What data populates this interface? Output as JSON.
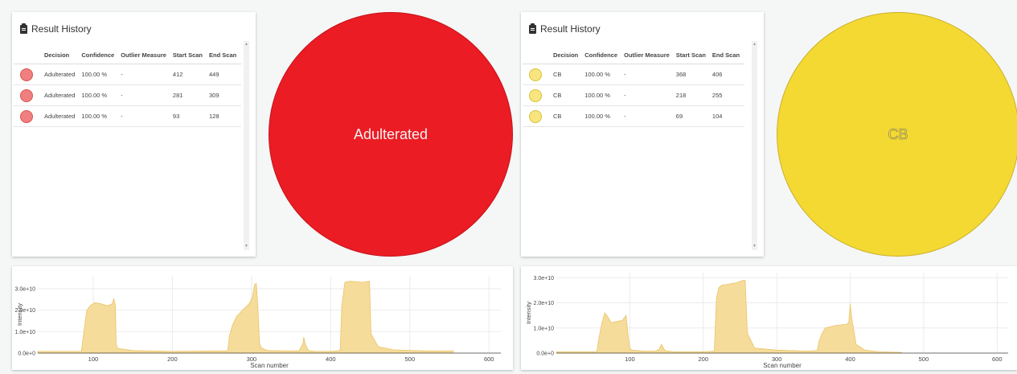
{
  "left_panel": {
    "title": "Result History",
    "columns": [
      "",
      "Decision",
      "Confidence",
      "Outlier Measure",
      "Start Scan",
      "End Scan"
    ],
    "rows": [
      {
        "decision": "Adulterated",
        "confidence": "100.00 %",
        "outlier": "-",
        "start": "412",
        "end": "449"
      },
      {
        "decision": "Adulterated",
        "confidence": "100.00 %",
        "outlier": "-",
        "start": "281",
        "end": "309"
      },
      {
        "decision": "Adulterated",
        "confidence": "100.00 %",
        "outlier": "-",
        "start": "93",
        "end": "128"
      }
    ],
    "status_label": "Adulterated",
    "status_color": "#ec1c24"
  },
  "right_panel": {
    "title": "Result History",
    "columns": [
      "",
      "Decision",
      "Confidence",
      "Outlier Measure",
      "Start Scan",
      "End Scan"
    ],
    "rows": [
      {
        "decision": "CB",
        "confidence": "100.00 %",
        "outlier": "-",
        "start": "368",
        "end": "406"
      },
      {
        "decision": "CB",
        "confidence": "100.00 %",
        "outlier": "-",
        "start": "218",
        "end": "255"
      },
      {
        "decision": "CB",
        "confidence": "100.00 %",
        "outlier": "-",
        "start": "69",
        "end": "104"
      }
    ],
    "status_label": "CB",
    "status_color": "#f5d933"
  },
  "icons": {
    "title_icon": "clipboard-icon",
    "row_icon": "decision-dot-icon"
  },
  "chart_data": [
    {
      "type": "area",
      "title": "",
      "xlabel": "Scan number",
      "ylabel": "Intensity",
      "xlim": [
        30,
        615
      ],
      "ylim": [
        0,
        36000000000.0
      ],
      "xticks": [
        100,
        200,
        300,
        400,
        500,
        600
      ],
      "yticks": [
        0,
        10000000000.0,
        20000000000.0,
        30000000000.0
      ],
      "ytick_labels": [
        "0.0e+0",
        "1.0e+10",
        "2.0e+10",
        "3.0e+10"
      ],
      "fill_color": "#f6dc9a",
      "line_color": "#e9c56a",
      "grid": true,
      "x": [
        30,
        85,
        90,
        92,
        96,
        102,
        110,
        118,
        124,
        126,
        128,
        129,
        131,
        150,
        200,
        250,
        270,
        272,
        276,
        281,
        290,
        297,
        301,
        304,
        306,
        308,
        310,
        312,
        320,
        340,
        360,
        365,
        366,
        368,
        372,
        380,
        400,
        412,
        414,
        418,
        425,
        440,
        449,
        451,
        460,
        480,
        520,
        555
      ],
      "y": [
        800000000.0,
        800000000.0,
        15000000000.0,
        20000000000.0,
        22000000000.0,
        23500000000.0,
        23000000000.0,
        22000000000.0,
        23000000000.0,
        25500000000.0,
        22000000000.0,
        4000000000.0,
        2200000000.0,
        1200000000.0,
        800000000.0,
        1000000000.0,
        1000000000.0,
        8000000000.0,
        13000000000.0,
        17000000000.0,
        20500000000.0,
        23000000000.0,
        26000000000.0,
        32000000000.0,
        32500000000.0,
        22000000000.0,
        5000000000.0,
        2500000000.0,
        1200000000.0,
        1000000000.0,
        1000000000.0,
        4500000000.0,
        7500000000.0,
        4000000000.0,
        1200000000.0,
        800000000.0,
        800000000.0,
        1200000000.0,
        22000000000.0,
        33000000000.0,
        33500000000.0,
        33000000000.0,
        33500000000.0,
        9000000000.0,
        3000000000.0,
        1500000000.0,
        1000000000.0,
        1000000000.0
      ]
    },
    {
      "type": "area",
      "title": "",
      "xlabel": "Scan number",
      "ylabel": "Intensity",
      "xlim": [
        0,
        615
      ],
      "ylim": [
        0,
        32000000000.0
      ],
      "xticks": [
        100,
        200,
        300,
        400,
        500,
        600
      ],
      "yticks": [
        0,
        10000000000.0,
        20000000000.0,
        30000000000.0
      ],
      "ytick_labels": [
        "0.0e+0",
        "1.0e+10",
        "2.0e+10",
        "3.0e+10"
      ],
      "fill_color": "#f6dc9a",
      "line_color": "#e9c56a",
      "grid": true,
      "x": [
        0,
        55,
        58,
        62,
        66,
        70,
        75,
        80,
        90,
        95,
        98,
        100,
        103,
        120,
        135,
        140,
        143,
        148,
        160,
        200,
        215,
        218,
        221,
        225,
        235,
        245,
        255,
        257,
        260,
        270,
        300,
        340,
        355,
        358,
        362,
        366,
        380,
        395,
        398,
        400,
        403,
        405,
        408,
        420,
        440,
        470
      ],
      "y": [
        500000000.0,
        500000000.0,
        6000000000.0,
        12000000000.0,
        16000000000.0,
        14500000000.0,
        12000000000.0,
        12500000000.0,
        13000000000.0,
        15000000000.0,
        6000000000.0,
        2000000000.0,
        1200000000.0,
        800000000.0,
        800000000.0,
        1500000000.0,
        3500000000.0,
        1000000000.0,
        500000000.0,
        500000000.0,
        800000000.0,
        22000000000.0,
        26000000000.0,
        27000000000.0,
        27500000000.0,
        28000000000.0,
        29000000000.0,
        29000000000.0,
        8000000000.0,
        2000000000.0,
        1200000000.0,
        800000000.0,
        1000000000.0,
        5000000000.0,
        8000000000.0,
        10000000000.0,
        11000000000.0,
        11500000000.0,
        12000000000.0,
        19500000000.0,
        12000000000.0,
        9000000000.0,
        3500000000.0,
        1200000000.0,
        500000000.0,
        300000000.0
      ]
    }
  ]
}
